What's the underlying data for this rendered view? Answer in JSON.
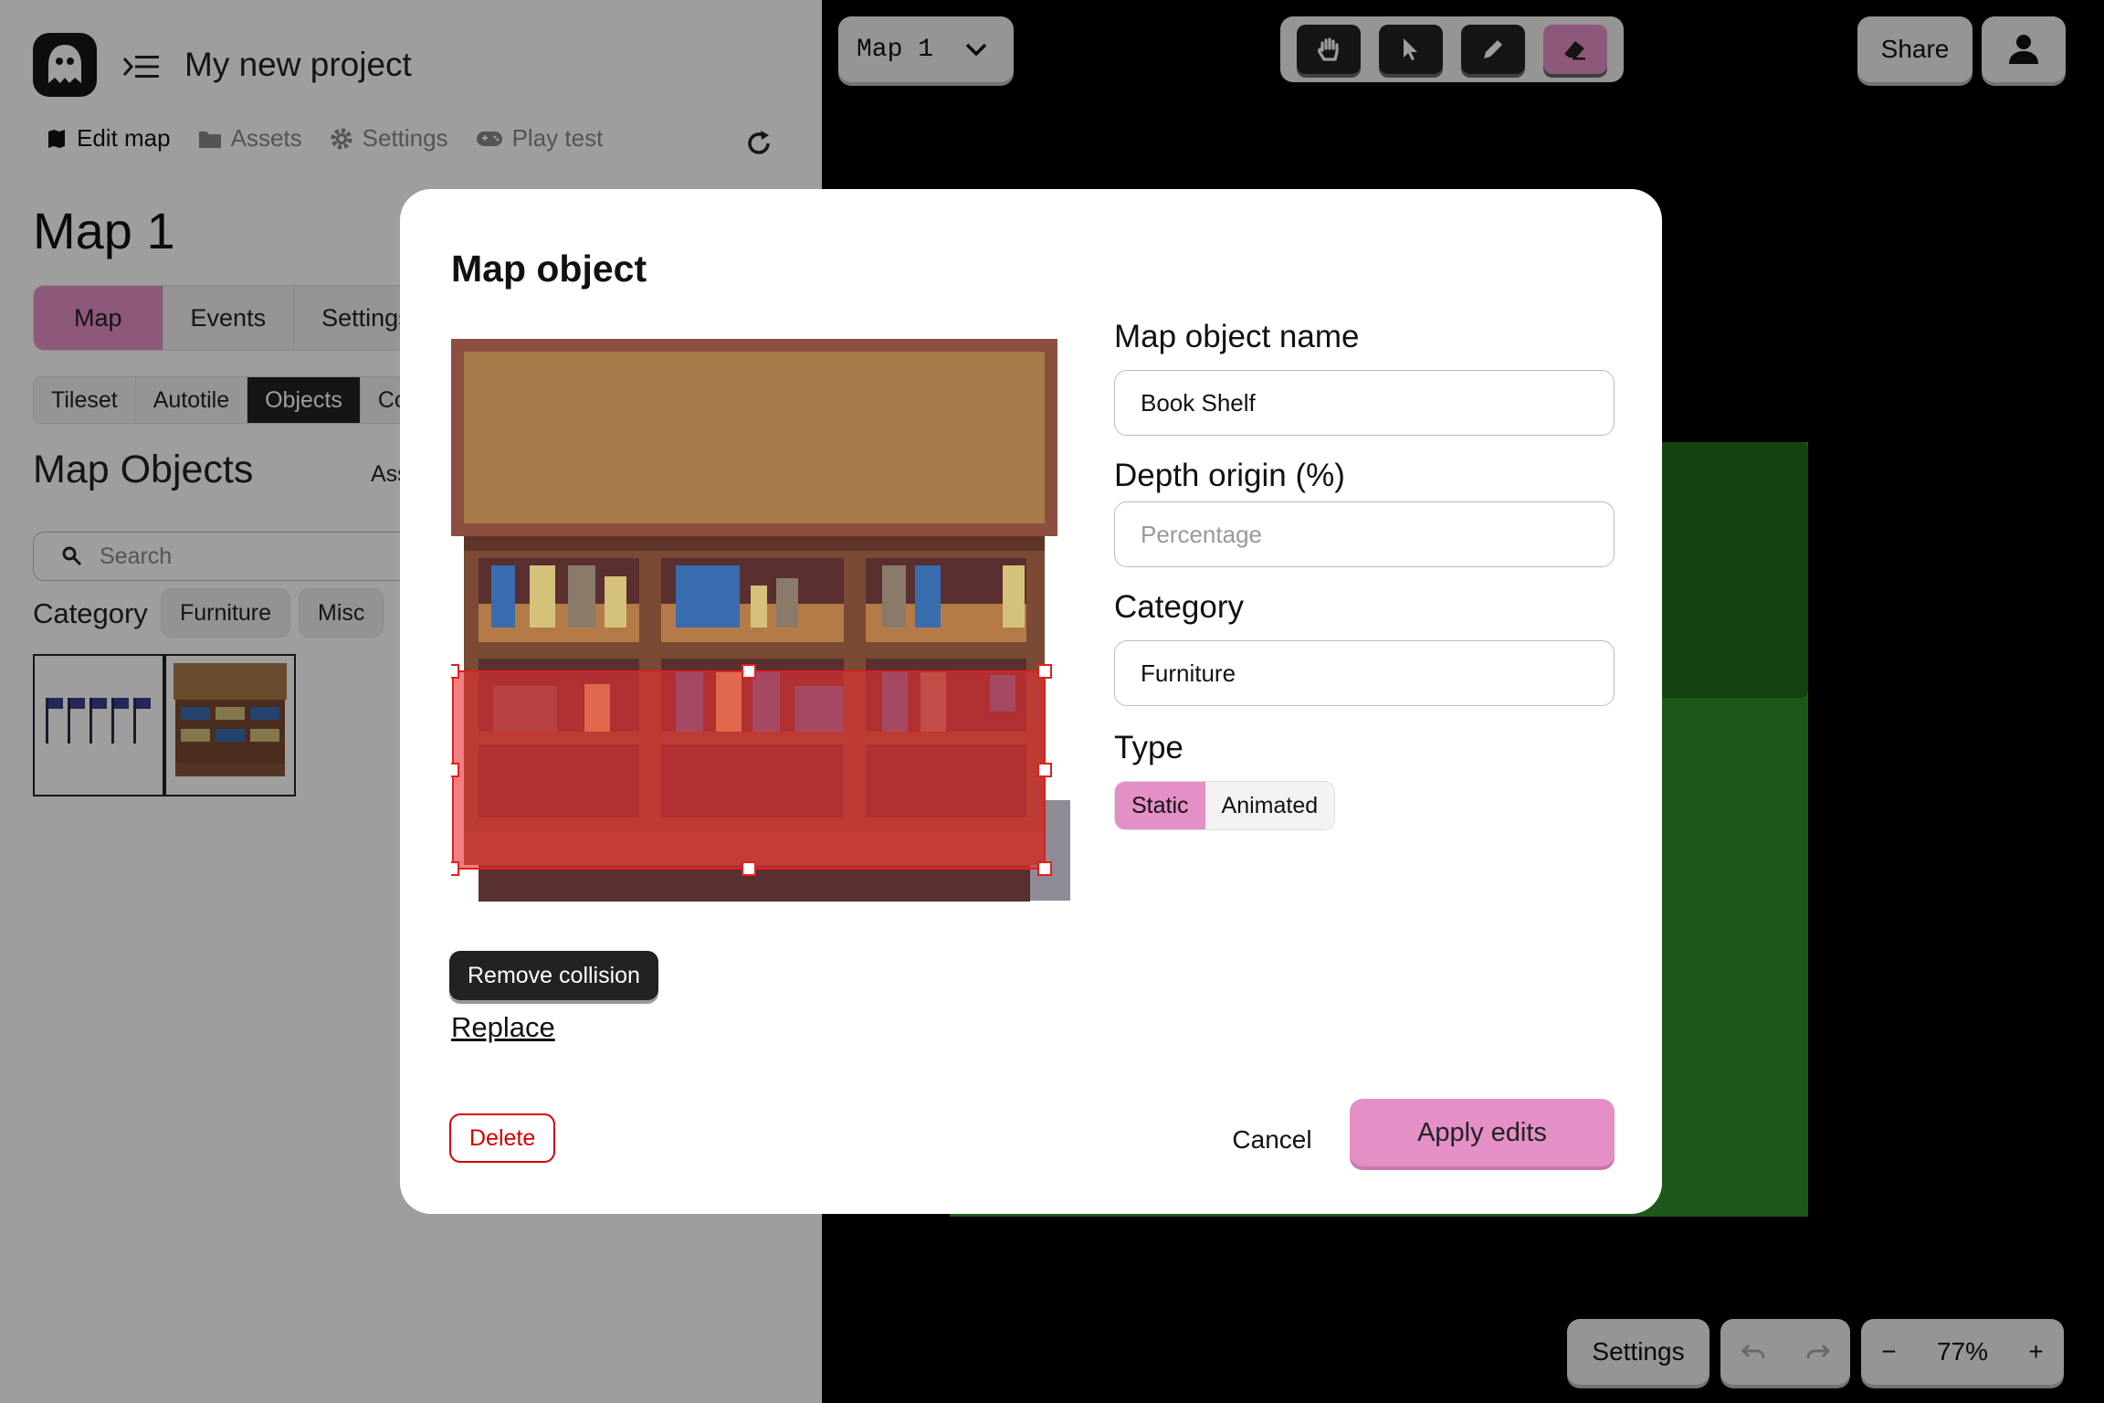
{
  "app": {
    "project_title": "My new project",
    "nav": [
      {
        "label": "Edit map",
        "icon": "map-icon"
      },
      {
        "label": "Assets",
        "icon": "folder-icon"
      },
      {
        "label": "Settings",
        "icon": "gear-icon"
      },
      {
        "label": "Play test",
        "icon": "gamepad-icon"
      }
    ]
  },
  "left_panel": {
    "map_title": "Map 1",
    "main_tabs": [
      "Map",
      "Events",
      "Settings"
    ],
    "sub_tabs": [
      "Tileset",
      "Autotile",
      "Objects",
      "Co"
    ],
    "objects_title": "Map Objects",
    "assets_partial": "Ass",
    "search_placeholder": "Search",
    "category_label": "Category",
    "category_chips": [
      "Furniture",
      "Misc"
    ]
  },
  "canvas": {
    "map_selector": "Map 1",
    "share_label": "Share",
    "settings_label": "Settings",
    "zoom_value": "77%",
    "zoom_minus": "−",
    "zoom_plus": "+"
  },
  "modal": {
    "title": "Map object",
    "remove_collision_label": "Remove collision",
    "replace_label": "Replace",
    "delete_label": "Delete",
    "name_label": "Map object name",
    "name_value": "Book Shelf",
    "depth_label": "Depth origin (%)",
    "depth_placeholder": "Percentage",
    "category_label": "Category",
    "category_value": "Furniture",
    "type_label": "Type",
    "type_options": [
      "Static",
      "Animated"
    ],
    "cancel_label": "Cancel",
    "apply_label": "Apply edits"
  },
  "colors": {
    "accent_pink": "#e58fc7",
    "danger_red": "#d40000",
    "grass_green": "#2f8f2a"
  }
}
